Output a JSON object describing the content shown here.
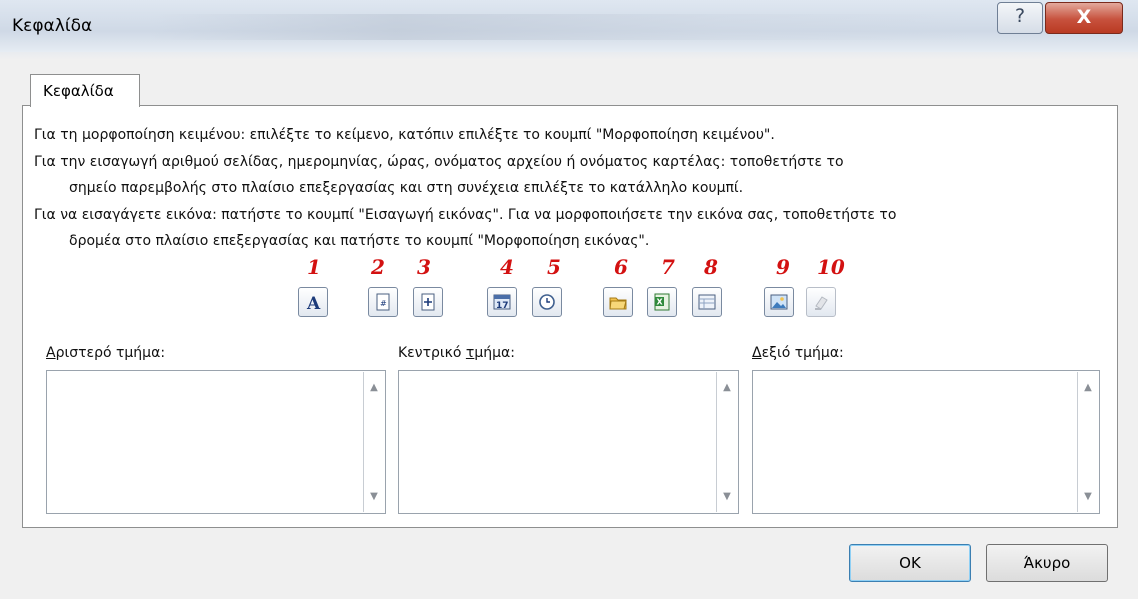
{
  "dialog": {
    "title": "Κεφαλίδα",
    "help_label": "?",
    "close_label": "X"
  },
  "tab": {
    "label": "Κεφαλίδα"
  },
  "instructions": {
    "line1": "Για τη μορφοποίηση κειμένου: επιλέξτε το κείμενο, κατόπιν επιλέξτε το κουμπί \"Μορφοποίηση κειμένου\".",
    "line2": "Για την εισαγωγή αριθμού σελίδας, ημερομηνίας, ώρας, ονόματος αρχείου ή ονόματος καρτέλας:  τοποθετήστε το",
    "line3": "σημείο παρεμβολής στο πλαίσιο επεξεργασίας και στη συνέχεια επιλέξτε το κατάλληλο κουμπί.",
    "line4": "Για να εισαγάγετε εικόνα: πατήστε το κουμπί \"Εισαγωγή εικόνας\". Για να μορφοποιήσετε την εικόνα σας, τοποθετήστε το",
    "line5": "δρομέα στο πλαίσιο επεξεργασίας και πατήστε το κουμπί \"Μορφοποίηση εικόνας\"."
  },
  "toolbar": {
    "numbers": [
      "1",
      "2",
      "3",
      "4",
      "5",
      "6",
      "7",
      "8",
      "9",
      "10"
    ],
    "buttons": [
      {
        "icon": "format-text-icon",
        "glyph": "A"
      },
      {
        "icon": "page-number-icon"
      },
      {
        "icon": "number-of-pages-icon"
      },
      {
        "icon": "date-icon"
      },
      {
        "icon": "time-icon"
      },
      {
        "icon": "file-path-icon"
      },
      {
        "icon": "file-name-icon"
      },
      {
        "icon": "sheet-name-icon"
      },
      {
        "icon": "insert-picture-icon"
      },
      {
        "icon": "format-picture-icon",
        "disabled": true
      }
    ]
  },
  "sections": {
    "left": {
      "label_u": "Α",
      "label_rest": "ριστερό τμήμα:",
      "value": ""
    },
    "center": {
      "label_pre": "Κεντρικό ",
      "label_u": "τ",
      "label_rest": "μήμα:",
      "value": ""
    },
    "right": {
      "label_u": "Δ",
      "label_rest": "εξιό τμήμα:",
      "value": ""
    }
  },
  "scroll": {
    "up": "▲",
    "down": "▼"
  },
  "buttons": {
    "ok": "OK",
    "cancel": "Άκυρο"
  },
  "colors": {
    "annotation": "#d31111",
    "close_button": "#c7513d"
  }
}
